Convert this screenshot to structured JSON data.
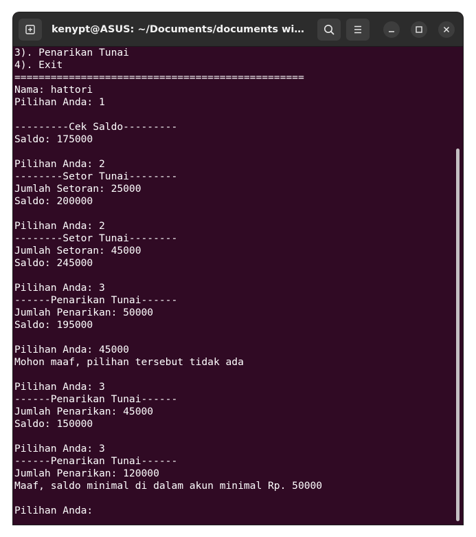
{
  "window": {
    "title": "kenypt@ASUS: ~/Documents/documents windows"
  },
  "icons": {
    "new_tab": "new-tab-icon",
    "search": "search-icon",
    "menu": "hamburger-menu-icon",
    "minimize": "minimize-icon",
    "maximize": "maximize-icon",
    "close": "close-icon"
  },
  "colors": {
    "terminal_background": "#300a24",
    "titlebar_background": "#2c2c2c",
    "text": "#ffffff"
  },
  "terminal": {
    "lines": [
      "3). Penarikan Tunai",
      "4). Exit",
      "================================================",
      "Nama: hattori",
      "Pilihan Anda: 1",
      "",
      "---------Cek Saldo---------",
      "Saldo: 175000",
      "",
      "Pilihan Anda: 2",
      "--------Setor Tunai--------",
      "Jumlah Setoran: 25000",
      "Saldo: 200000",
      "",
      "Pilihan Anda: 2",
      "--------Setor Tunai--------",
      "Jumlah Setoran: 45000",
      "Saldo: 245000",
      "",
      "Pilihan Anda: 3",
      "------Penarikan Tunai------",
      "Jumlah Penarikan: 50000",
      "Saldo: 195000",
      "",
      "Pilihan Anda: 45000",
      "Mohon maaf, pilihan tersebut tidak ada",
      "",
      "Pilihan Anda: 3",
      "------Penarikan Tunai------",
      "Jumlah Penarikan: 45000",
      "Saldo: 150000",
      "",
      "Pilihan Anda: 3",
      "------Penarikan Tunai------",
      "Jumlah Penarikan: 120000",
      "Maaf, saldo minimal di dalam akun minimal Rp. 50000",
      "",
      "Pilihan Anda: "
    ]
  }
}
